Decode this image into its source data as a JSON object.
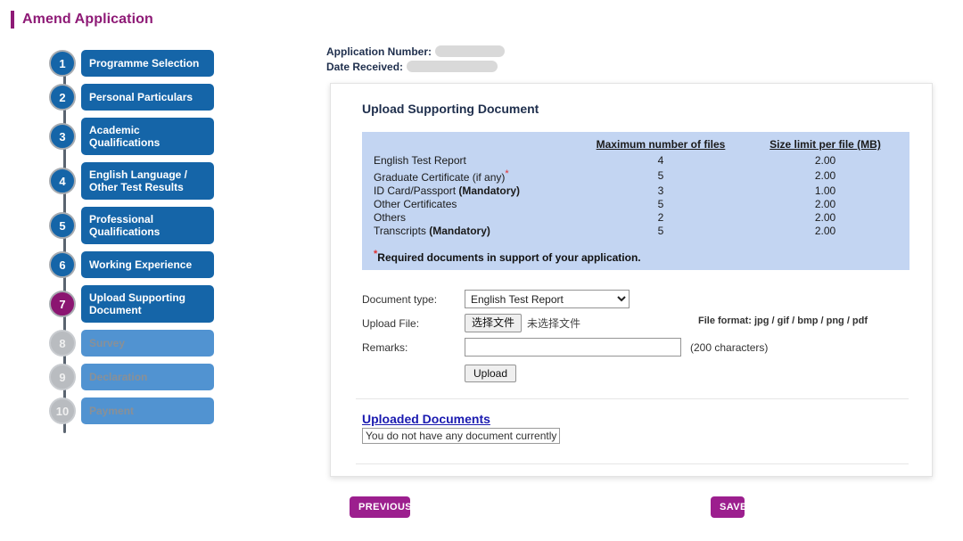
{
  "page": {
    "title": "Amend Application"
  },
  "meta": {
    "application_number_label": "Application Number:",
    "date_received_label": "Date Received:"
  },
  "stepper": {
    "steps": [
      {
        "number": "1",
        "label": "Programme Selection",
        "state": "done"
      },
      {
        "number": "2",
        "label": "Personal Particulars",
        "state": "done"
      },
      {
        "number": "3",
        "label": "Academic Qualifications",
        "state": "done"
      },
      {
        "number": "4",
        "label": "English Language / Other Test Results",
        "state": "done"
      },
      {
        "number": "5",
        "label": "Professional Qualifications",
        "state": "done"
      },
      {
        "number": "6",
        "label": "Working Experience",
        "state": "done"
      },
      {
        "number": "7",
        "label": "Upload Supporting Document",
        "state": "active"
      },
      {
        "number": "8",
        "label": "Survey",
        "state": "disabled"
      },
      {
        "number": "9",
        "label": "Declaration",
        "state": "disabled"
      },
      {
        "number": "10",
        "label": "Payment",
        "state": "disabled"
      }
    ]
  },
  "card": {
    "title": "Upload Supporting Document",
    "table": {
      "headers": {
        "name": "",
        "max_files": "Maximum number of files",
        "size_limit": "Size limit per file (MB)"
      },
      "rows": [
        {
          "name": "English Test Report",
          "suffix": "",
          "star": false,
          "max_files": "4",
          "size_limit": "2.00"
        },
        {
          "name": "Graduate Certificate (if any)",
          "suffix": "",
          "star": true,
          "max_files": "5",
          "size_limit": "2.00"
        },
        {
          "name": "ID Card/Passport ",
          "suffix": "(Mandatory)",
          "star": false,
          "max_files": "3",
          "size_limit": "1.00"
        },
        {
          "name": "Other Certificates",
          "suffix": "",
          "star": false,
          "max_files": "5",
          "size_limit": "2.00"
        },
        {
          "name": "Others",
          "suffix": "",
          "star": false,
          "max_files": "2",
          "size_limit": "2.00"
        },
        {
          "name": "Transcripts ",
          "suffix": "(Mandatory)",
          "star": false,
          "max_files": "5",
          "size_limit": "2.00"
        }
      ],
      "note": "Required documents in support of your application."
    },
    "form": {
      "document_type_label": "Document type:",
      "document_type_value": "English Test Report",
      "document_type_options": [
        "English Test Report",
        "Graduate Certificate (if any)",
        "ID Card/Passport",
        "Other Certificates",
        "Others",
        "Transcripts"
      ],
      "upload_file_label": "Upload File:",
      "file_button_label": "选择文件",
      "file_status_text": "未选择文件",
      "file_format_text": "File format: jpg / gif / bmp / png / pdf",
      "remarks_label": "Remarks:",
      "remarks_value": "",
      "remarks_placeholder": "",
      "remarks_hint": "(200 characters)",
      "upload_button_label": "Upload"
    },
    "uploaded": {
      "title": "Uploaded Documents",
      "empty_message": "You do not have any document currently"
    }
  },
  "footer": {
    "previous_label": "PREVIOUS",
    "save_label": "SAVE"
  },
  "colors": {
    "accent_purple": "#8e1a76",
    "button_purple": "#9c1f8e",
    "step_blue": "#1565a8",
    "step_blue_disabled": "#5193d1",
    "table_blue": "#c3d5f2",
    "link_blue": "#1a1ab0",
    "required_red": "#e03030"
  }
}
